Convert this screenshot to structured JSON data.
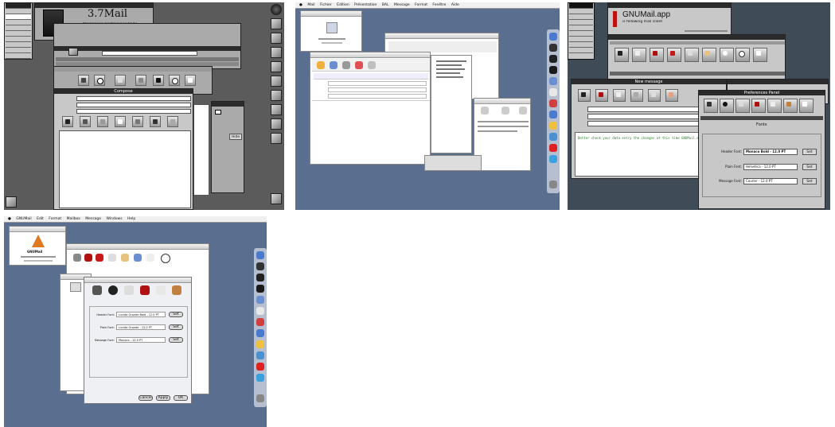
{
  "thumb1": {
    "mail_title": "3.7Mail",
    "mail_subtitle": "Messagerie électronique NeXT",
    "compose_title": "Compose",
    "hide_button": "Hide"
  },
  "thumb2": {
    "menubar": [
      "Mail",
      "Fichier",
      "Édition",
      "Présentation",
      "BAL",
      "Message",
      "Format",
      "Fenêtre",
      "Aide"
    ]
  },
  "thumb3": {
    "app_title": "GNUMail.app",
    "app_tagline": "is following mail client",
    "new_message_title": "New message",
    "preferences_title": "Preferences Panel",
    "font_section": "Fonts",
    "body_text": "Better check your data entry the changes at this time GNUMail.app",
    "pref_rows": [
      {
        "label": "Header Font:",
        "value": "Monaco Bold - 12.0 PT",
        "button": "Set"
      },
      {
        "label": "Plain Font:",
        "value": "Helvetica - 12.0 PT",
        "button": "Set"
      },
      {
        "label": "Message Font:",
        "value": "Courier - 12.0 PT",
        "button": "Set"
      }
    ]
  },
  "thumb4": {
    "menubar": [
      "GNUMail",
      "Edit",
      "Format",
      "Mailbox",
      "Message",
      "Windows",
      "Help"
    ],
    "about_caption": "GNUMail",
    "pref_rows": [
      {
        "label": "Header Font:",
        "value": "Lucida Grande Bold - 12.0 PT",
        "button": "Set"
      },
      {
        "label": "Plain Font:",
        "value": "Lucida Grande - 12.0 PT",
        "button": "Set"
      },
      {
        "label": "Message Font:",
        "value": "Monaco - 12.0 PT",
        "button": "Set"
      }
    ],
    "bottom_buttons": [
      "Cancel",
      "Apply",
      "OK"
    ]
  }
}
